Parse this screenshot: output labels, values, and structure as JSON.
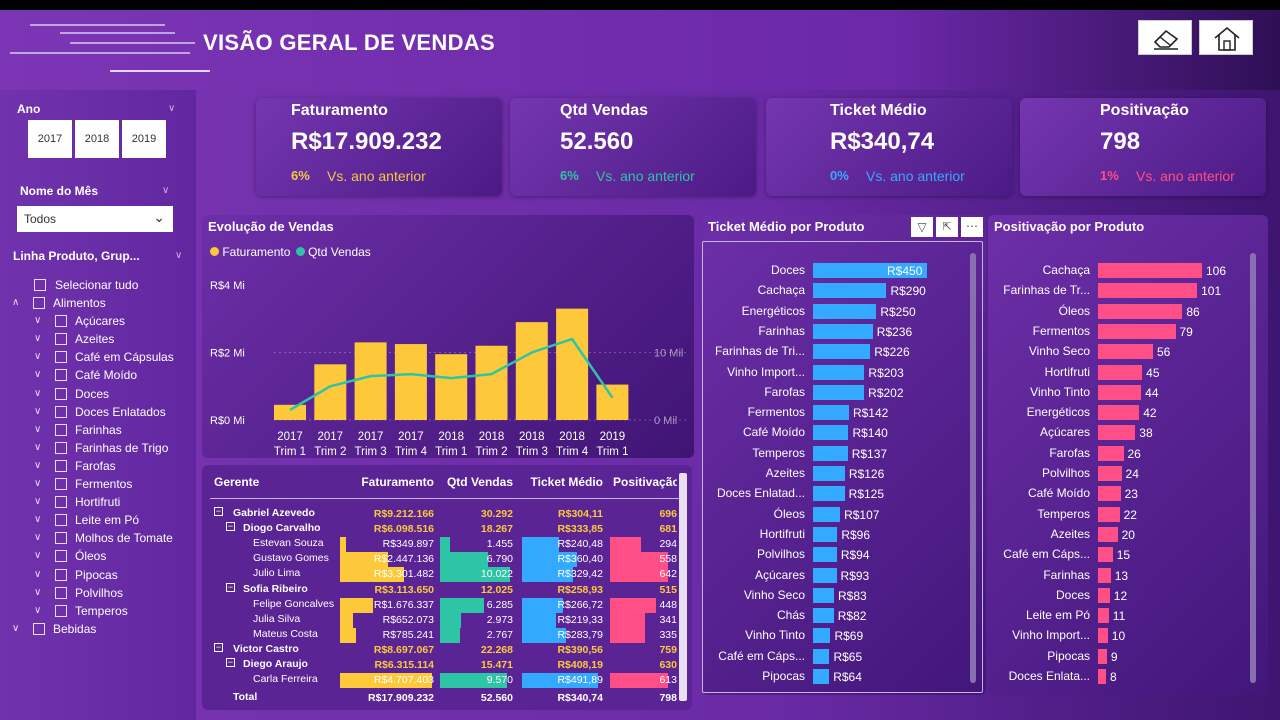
{
  "title": "VISÃO GERAL DE VENDAS",
  "header_buttons": [
    "eraser-icon",
    "home-icon"
  ],
  "filters": {
    "ano_label": "Ano",
    "years": [
      "2017",
      "2018",
      "2019"
    ],
    "mes_label": "Nome do Mês",
    "mes_value": "Todos",
    "linha_label": "Linha Produto, Grup...",
    "select_all": "Selecionar tudo",
    "tree": [
      {
        "label": "Alimentos",
        "level": 0
      },
      {
        "label": "Açúcares",
        "level": 1
      },
      {
        "label": "Azeites",
        "level": 1
      },
      {
        "label": "Café em Cápsulas",
        "level": 1
      },
      {
        "label": "Café Moído",
        "level": 1
      },
      {
        "label": "Doces",
        "level": 1
      },
      {
        "label": "Doces Enlatados",
        "level": 1
      },
      {
        "label": "Farinhas",
        "level": 1
      },
      {
        "label": "Farinhas de Trigo",
        "level": 1
      },
      {
        "label": "Farofas",
        "level": 1
      },
      {
        "label": "Fermentos",
        "level": 1
      },
      {
        "label": "Hortifruti",
        "level": 1
      },
      {
        "label": "Leite em Pó",
        "level": 1
      },
      {
        "label": "Molhos de Tomate",
        "level": 1
      },
      {
        "label": "Óleos",
        "level": 1
      },
      {
        "label": "Pipocas",
        "level": 1
      },
      {
        "label": "Polvilhos",
        "level": 1
      },
      {
        "label": "Temperos",
        "level": 1
      },
      {
        "label": "Bebidas",
        "level": 0
      }
    ]
  },
  "kpis": [
    {
      "title": "Faturamento",
      "value": "R$17.909.232",
      "pct": "6%",
      "note": "Vs. ano anterior",
      "color": "#f5c842"
    },
    {
      "title": "Qtd Vendas",
      "value": "52.560",
      "pct": "6%",
      "note": "Vs. ano anterior",
      "color": "#2ec4a6"
    },
    {
      "title": "Ticket Médio",
      "value": "R$340,74",
      "pct": "0%",
      "note": "Vs. ano anterior",
      "color": "#3aa8ff"
    },
    {
      "title": "Positivação",
      "value": "798",
      "pct": "1%",
      "note": "Vs. ano anterior",
      "color": "#ff4f86"
    }
  ],
  "chart_data": [
    {
      "type": "bar",
      "title": "Evolução de Vendas",
      "legend": [
        "Faturamento",
        "Qtd Vendas"
      ],
      "categories": [
        [
          "2017",
          "Trim 1"
        ],
        [
          "2017",
          "Trim 2"
        ],
        [
          "2017",
          "Trim 3"
        ],
        [
          "2017",
          "Trim 4"
        ],
        [
          "2018",
          "Trim 1"
        ],
        [
          "2018",
          "Trim 2"
        ],
        [
          "2018",
          "Trim 3"
        ],
        [
          "2018",
          "Trim 4"
        ],
        [
          "2019",
          "Trim 1"
        ]
      ],
      "series": [
        {
          "name": "Faturamento",
          "type": "bar",
          "values": [
            0.45,
            1.65,
            2.3,
            2.25,
            1.95,
            2.2,
            2.9,
            3.3,
            1.05
          ],
          "color": "#fdc93a"
        },
        {
          "name": "Qtd Vendas",
          "type": "line",
          "values": [
            1.5,
            5.0,
            6.5,
            6.8,
            6.2,
            6.8,
            10.0,
            12.0,
            3.3
          ],
          "color": "#2ec4a6"
        }
      ],
      "y_left_ticks": [
        "R$0 Mi",
        "R$2 Mi",
        "R$4 Mi"
      ],
      "y_left_range": [
        0,
        4
      ],
      "y_right_ticks": [
        "0 Mil",
        "10 Mil"
      ],
      "y_right_range": [
        0,
        20
      ]
    },
    {
      "type": "bar",
      "orientation": "horizontal",
      "title": "Ticket Médio por Produto",
      "categories": [
        "Doces",
        "Cachaça",
        "Energéticos",
        "Farinhas",
        "Farinhas de Tri...",
        "Vinho Import...",
        "Farofas",
        "Fermentos",
        "Café Moído",
        "Temperos",
        "Azeites",
        "Doces Enlatad...",
        "Óleos",
        "Hortifruti",
        "Polvilhos",
        "Açúcares",
        "Vinho Seco",
        "Chás",
        "Vinho Tinto",
        "Café em Cáps...",
        "Pipocas"
      ],
      "values": [
        450,
        290,
        250,
        236,
        226,
        203,
        202,
        142,
        140,
        137,
        126,
        125,
        107,
        96,
        94,
        93,
        83,
        82,
        69,
        65,
        64
      ],
      "labels": [
        "R$450",
        "R$290",
        "R$250",
        "R$236",
        "R$226",
        "R$203",
        "R$202",
        "R$142",
        "R$140",
        "R$137",
        "R$126",
        "R$125",
        "R$107",
        "R$96",
        "R$94",
        "R$93",
        "R$83",
        "R$82",
        "R$69",
        "R$65",
        "R$64"
      ],
      "color": "#33aaff"
    },
    {
      "type": "bar",
      "orientation": "horizontal",
      "title": "Positivação por Produto",
      "categories": [
        "Cachaça",
        "Farinhas de Tr...",
        "Óleos",
        "Fermentos",
        "Vinho Seco",
        "Hortifruti",
        "Vinho Tinto",
        "Energéticos",
        "Açúcares",
        "Farofas",
        "Polvilhos",
        "Café Moído",
        "Temperos",
        "Azeites",
        "Café em Cáps...",
        "Farinhas",
        "Doces",
        "Leite em Pó",
        "Vinho Import...",
        "Pipocas",
        "Doces Enlata..."
      ],
      "values": [
        106,
        101,
        86,
        79,
        56,
        45,
        44,
        42,
        38,
        26,
        24,
        23,
        22,
        20,
        15,
        13,
        12,
        11,
        10,
        9,
        8
      ],
      "color": "#ff4f86"
    }
  ],
  "table": {
    "headers": [
      "Gerente",
      "Faturamento",
      "Qtd Vendas",
      "Ticket Médio",
      "Positivação"
    ],
    "rows": [
      {
        "level": 0,
        "expand": true,
        "name": "Gabriel Azevedo",
        "fat": "R$9.212.166",
        "qtd": "30.292",
        "tm": "R$304,11",
        "pos": "696"
      },
      {
        "level": 1,
        "expand": true,
        "name": "Diogo Carvalho",
        "fat": "R$6.098.516",
        "qtd": "18.267",
        "tm": "R$333,85",
        "pos": "681"
      },
      {
        "level": 2,
        "name": "Estevan Souza",
        "fat": "R$349.897",
        "qtd": "1.455",
        "tm": "R$240,48",
        "pos": "294",
        "fb": 0.07,
        "qb": 0.14,
        "tb": 0.49,
        "pb": 0.53
      },
      {
        "level": 2,
        "name": "Gustavo Gomes",
        "fat": "R$2.447.136",
        "qtd": "6.790",
        "tm": "R$360,40",
        "pos": "558",
        "fb": 0.52,
        "qb": 0.68,
        "tb": 0.73,
        "pb": 1.0
      },
      {
        "level": 2,
        "name": "Julio Lima",
        "fat": "R$3.301.482",
        "qtd": "10.022",
        "tm": "R$329,42",
        "pos": "642",
        "fb": 0.7,
        "qb": 1.0,
        "tb": 0.67,
        "pb": 1.0
      },
      {
        "level": 1,
        "expand": true,
        "name": "Sofia Ribeiro",
        "fat": "R$3.113.650",
        "qtd": "12.025",
        "tm": "R$258,93",
        "pos": "515"
      },
      {
        "level": 2,
        "name": "Felipe Goncalves",
        "fat": "R$1.676.337",
        "qtd": "6.285",
        "tm": "R$266,72",
        "pos": "448",
        "fb": 0.36,
        "qb": 0.63,
        "tb": 0.54,
        "pb": 0.8
      },
      {
        "level": 2,
        "name": "Julia Silva",
        "fat": "R$652.073",
        "qtd": "2.973",
        "tm": "R$219,33",
        "pos": "341",
        "fb": 0.14,
        "qb": 0.3,
        "tb": 0.45,
        "pb": 0.61
      },
      {
        "level": 2,
        "name": "Mateus Costa",
        "fat": "R$785.241",
        "qtd": "2.767",
        "tm": "R$283,79",
        "pos": "335",
        "fb": 0.17,
        "qb": 0.28,
        "tb": 0.58,
        "pb": 0.6
      },
      {
        "level": 0,
        "expand": true,
        "name": "Victor Castro",
        "fat": "R$8.697.067",
        "qtd": "22.268",
        "tm": "R$390,56",
        "pos": "759"
      },
      {
        "level": 1,
        "expand": true,
        "name": "Diego Araujo",
        "fat": "R$6.315.114",
        "qtd": "15.471",
        "tm": "R$408,19",
        "pos": "630"
      },
      {
        "level": 2,
        "name": "Carla Ferreira",
        "fat": "R$4.707.403",
        "qtd": "9.570",
        "tm": "R$491,89",
        "pos": "613",
        "fb": 1.0,
        "qb": 0.95,
        "tb": 1.0,
        "pb": 1.0
      }
    ],
    "total": {
      "name": "Total",
      "fat": "R$17.909.232",
      "qtd": "52.560",
      "tm": "R$340,74",
      "pos": "798"
    }
  }
}
